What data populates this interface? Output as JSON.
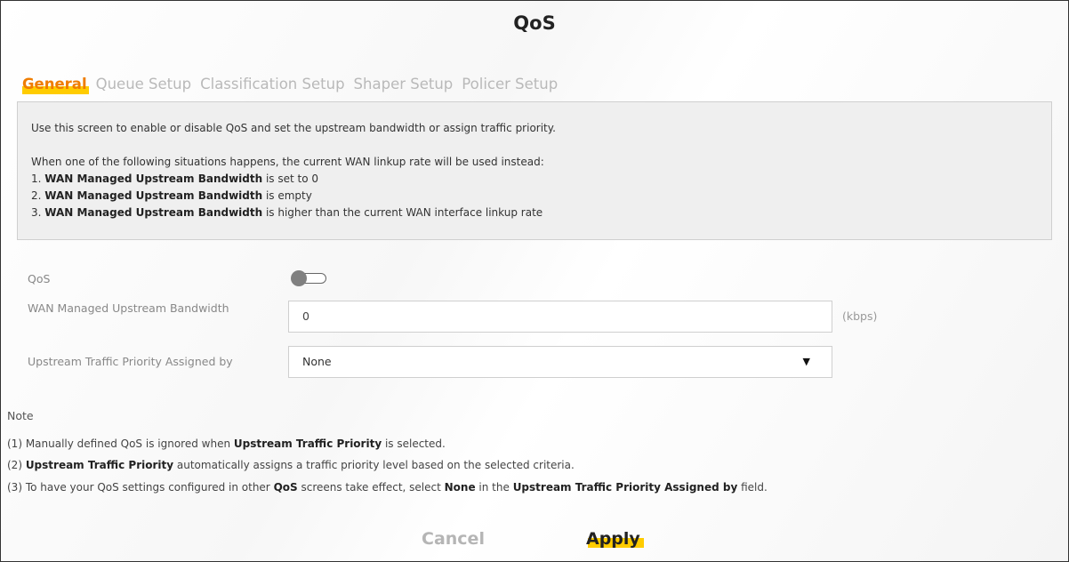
{
  "page": {
    "title": "QoS"
  },
  "tabs": [
    {
      "label": "General",
      "active": true
    },
    {
      "label": "Queue Setup",
      "active": false
    },
    {
      "label": "Classification Setup",
      "active": false
    },
    {
      "label": "Shaper Setup",
      "active": false
    },
    {
      "label": "Policer Setup",
      "active": false
    }
  ],
  "info": {
    "intro": "Use this screen to enable or disable QoS and set the upstream bandwidth or assign traffic priority.",
    "situations_intro": "When one of the following situations happens, the current WAN linkup rate will be used instead:",
    "items": [
      {
        "num": "1. ",
        "bold": "WAN Managed Upstream Bandwidth",
        "rest": " is set to 0"
      },
      {
        "num": "2. ",
        "bold": "WAN Managed Upstream Bandwidth",
        "rest": " is empty"
      },
      {
        "num": "3. ",
        "bold": "WAN Managed Upstream Bandwidth",
        "rest": " is higher than the current WAN interface linkup rate"
      }
    ]
  },
  "form": {
    "qos_label": "QoS",
    "qos_enabled": false,
    "bandwidth_label": "WAN Managed Upstream Bandwidth",
    "bandwidth_value": "0",
    "bandwidth_unit": "(kbps)",
    "priority_label": "Upstream Traffic Priority Assigned by",
    "priority_value": "None"
  },
  "note": {
    "title": "Note",
    "n1_a": "(1) Manually defined QoS is ignored when ",
    "n1_b": "Upstream Traffic Priority",
    "n1_c": " is selected.",
    "n2_a": "(2) ",
    "n2_b": "Upstream Traffic Priority",
    "n2_c": " automatically assigns a traffic priority level based on the selected criteria.",
    "n3_a": "(3) To have your QoS settings configured in other ",
    "n3_b": "QoS",
    "n3_c": " screens take effect, select ",
    "n3_d": "None",
    "n3_e": " in the ",
    "n3_f": "Upstream Traffic Priority Assigned by",
    "n3_g": " field."
  },
  "buttons": {
    "cancel": "Cancel",
    "apply": "Apply"
  },
  "colors": {
    "accent": "#ffcc00",
    "active_tab_text": "#ef7d00",
    "info_bg": "#efefef"
  }
}
